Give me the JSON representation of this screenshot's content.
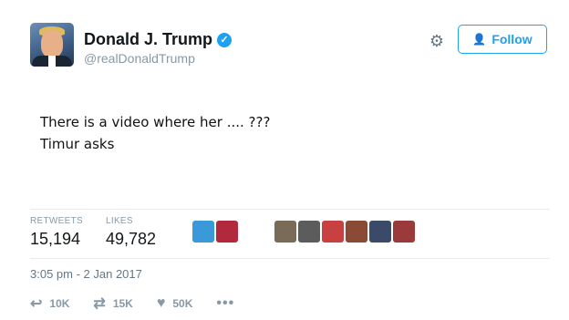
{
  "header": {
    "display_name": "Donald J. Trump",
    "handle": "@realDonaldTrump",
    "verified_icon": "verified-badge-icon",
    "follow_label": "Follow",
    "colors": {
      "accent": "#1da1f2",
      "text": "#14171a",
      "muted": "#8899a6"
    }
  },
  "tweet": {
    "lines": [
      "There is a video where her .... ???",
      "Timur asks"
    ]
  },
  "stats": {
    "retweets_label": "RETWEETS",
    "retweets_value": "15,194",
    "likes_label": "LIKES",
    "likes_value": "49,782"
  },
  "likers": [
    {
      "color": "#3a9ad9"
    },
    {
      "color": "#b2283c"
    },
    {
      "color": "#7a6a58"
    },
    {
      "color": "#5c5c5c"
    },
    {
      "color": "#c94040"
    },
    {
      "color": "#8a4a36"
    },
    {
      "color": "#3c4a6a"
    },
    {
      "color": "#9a3a3a"
    }
  ],
  "timestamp": "3:05 pm - 2 Jan 2017",
  "actions": {
    "reply_count": "10K",
    "retweet_count": "15K",
    "like_count": "50K"
  }
}
